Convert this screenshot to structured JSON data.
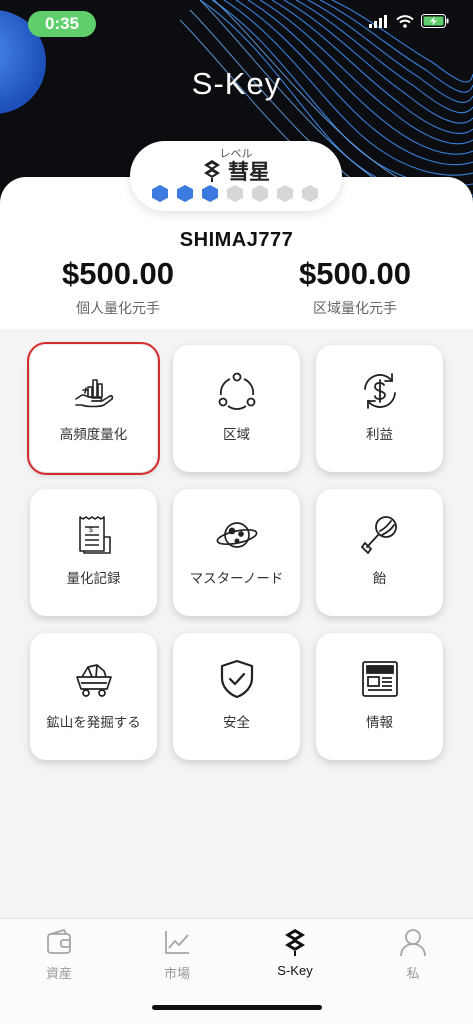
{
  "status": {
    "time": "0:35"
  },
  "app_title": "S-Key",
  "level": {
    "caption": "レベル",
    "name": "彗星",
    "total_dots": 7,
    "filled_dots": 3,
    "accent": "#3b7be0"
  },
  "user": {
    "name": "SHIMAJ777"
  },
  "balances": [
    {
      "value": "$500.00",
      "label": "個人量化元手"
    },
    {
      "value": "$500.00",
      "label": "区域量化元手"
    }
  ],
  "tiles": [
    {
      "label": "高頻度量化",
      "icon": "hand-chart-icon",
      "selected": true
    },
    {
      "label": "区域",
      "icon": "network-nodes-icon"
    },
    {
      "label": "利益",
      "icon": "dollar-exchange-icon"
    },
    {
      "label": "量化記録",
      "icon": "receipt-icon"
    },
    {
      "label": "マスターノード",
      "icon": "planet-icon"
    },
    {
      "label": "飴",
      "icon": "lollipop-icon"
    },
    {
      "label": "鉱山を発掘する",
      "icon": "mine-cart-icon"
    },
    {
      "label": "安全",
      "icon": "shield-check-icon"
    },
    {
      "label": "情報",
      "icon": "newspaper-icon"
    }
  ],
  "tabs": [
    {
      "label": "資産",
      "icon": "wallet-icon"
    },
    {
      "label": "市場",
      "icon": "market-chart-icon"
    },
    {
      "label": "S-Key",
      "icon": "skey-logo-icon",
      "active": true
    },
    {
      "label": "私",
      "icon": "user-icon"
    }
  ]
}
